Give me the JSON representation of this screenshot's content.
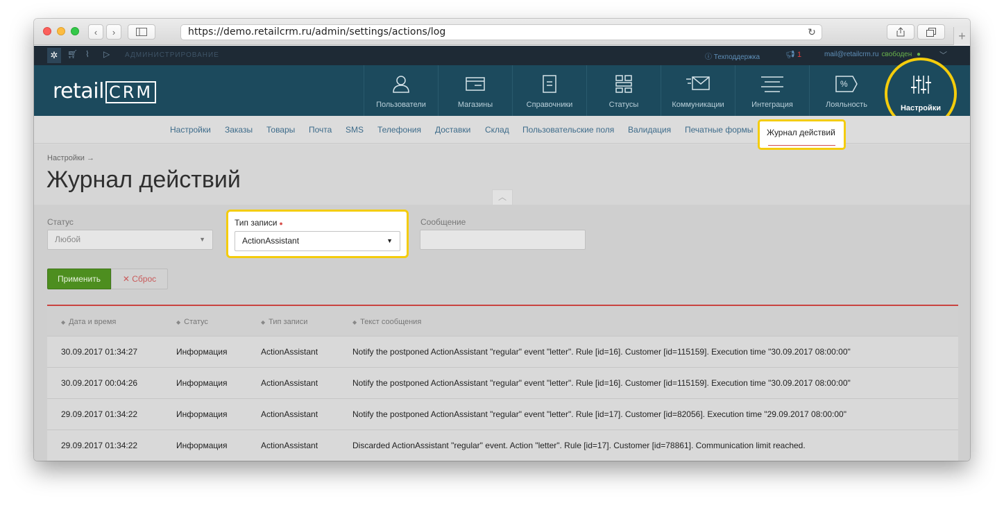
{
  "browser": {
    "url": "https://demo.retailcrm.ru/admin/settings/actions/log"
  },
  "adminbar": {
    "section_label": "АДМИНИСТРИРОВАНИЕ",
    "support_label": "Техподдержка",
    "notifications_count": "1",
    "user_email": "mail@retailcrm.ru",
    "user_status": "свободен"
  },
  "logo": {
    "prefix": "retail",
    "mark": "CRM"
  },
  "nav": {
    "items": [
      {
        "label": "Пользователи",
        "icon": "user-icon"
      },
      {
        "label": "Магазины",
        "icon": "store-icon"
      },
      {
        "label": "Справочники",
        "icon": "document-icon"
      },
      {
        "label": "Статусы",
        "icon": "statuses-icon"
      },
      {
        "label": "Коммуникации",
        "icon": "mail-icon"
      },
      {
        "label": "Интеграция",
        "icon": "integration-icon"
      },
      {
        "label": "Лояльность",
        "icon": "percent-tag-icon"
      }
    ],
    "active": {
      "label": "Настройки",
      "icon": "sliders-icon"
    }
  },
  "subnav": {
    "items": [
      "Настройки",
      "Заказы",
      "Товары",
      "Почта",
      "SMS",
      "Телефония",
      "Доставки",
      "Склад",
      "Пользовательские поля",
      "Валидация",
      "Печатные формы"
    ],
    "active": "Журнал действий"
  },
  "page": {
    "breadcrumb": "Настройки →",
    "title": "Журнал действий"
  },
  "filters": {
    "status_label": "Статус",
    "status_value": "Любой",
    "type_label": "Тип записи",
    "type_value": "ActionAssistant",
    "message_label": "Сообщение",
    "message_value": "",
    "apply_label": "Применить",
    "reset_label": "Сброс"
  },
  "table": {
    "columns": [
      "Дата и время",
      "Статус",
      "Тип записи",
      "Текст сообщения"
    ],
    "rows": [
      [
        "30.09.2017 01:34:27",
        "Информация",
        "ActionAssistant",
        "Notify the postponed ActionAssistant \"regular\" event \"letter\". Rule [id=16]. Customer [id=115159]. Execution time \"30.09.2017 08:00:00\""
      ],
      [
        "30.09.2017 00:04:26",
        "Информация",
        "ActionAssistant",
        "Notify the postponed ActionAssistant \"regular\" event \"letter\". Rule [id=16]. Customer [id=115159]. Execution time \"30.09.2017 08:00:00\""
      ],
      [
        "29.09.2017 01:34:22",
        "Информация",
        "ActionAssistant",
        "Notify the postponed ActionAssistant \"regular\" event \"letter\". Rule [id=17]. Customer [id=82056]. Execution time \"29.09.2017 08:00:00\""
      ],
      [
        "29.09.2017 01:34:22",
        "Информация",
        "ActionAssistant",
        "Discarded ActionAssistant \"regular\" event. Action \"letter\". Rule [id=17]. Customer [id=78861]. Communication limit reached."
      ]
    ]
  },
  "colors": {
    "header_bg": "#1c4a5d",
    "highlight": "#f4cc0c",
    "apply_button": "#4d8e1f",
    "accent_red": "#c9433f"
  }
}
